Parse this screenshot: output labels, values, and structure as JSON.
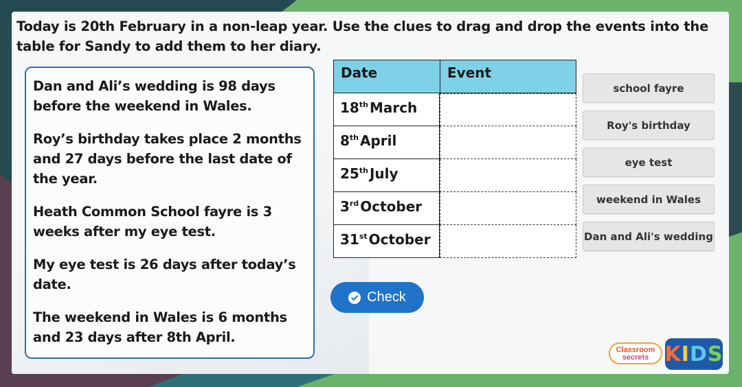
{
  "instructions": "Today is 20th February in a non-leap year. Use the clues to drag and drop the events into the table for Sandy to add them to her diary.",
  "clues": [
    "Dan and Ali’s wedding is 98 days before the weekend in Wales.",
    "Roy’s birthday takes place 2 months and 27 days before the last date of the year.",
    "Heath Common School fayre is 3 weeks after my eye test.",
    "My eye test is 26 days after today’s date.",
    "The weekend in Wales is 6 months and 23 days after 8th April."
  ],
  "table": {
    "headers": {
      "date": "Date",
      "event": "Event"
    },
    "rows": [
      {
        "day": "18",
        "suffix": "th",
        "month": "March"
      },
      {
        "day": "8",
        "suffix": "th",
        "month": "April"
      },
      {
        "day": "25",
        "suffix": "th",
        "month": "July"
      },
      {
        "day": "3",
        "suffix": "rd",
        "month": "October"
      },
      {
        "day": "31",
        "suffix": "st",
        "month": "October"
      }
    ]
  },
  "tiles": [
    "school fayre",
    "Roy's birthday",
    "eye test",
    "weekend in Wales",
    "Dan and Ali's wedding"
  ],
  "check_button": {
    "label": "Check",
    "icon": "check-circle-icon"
  },
  "logo": {
    "classroom": "Classroom",
    "secrets": "secrets",
    "kids_letters": [
      "K",
      "I",
      "D",
      "S"
    ],
    "kids_colors": [
      "#f26b3a",
      "#f7c948",
      "#5cc6e8",
      "#7dd15a"
    ]
  },
  "colors": {
    "header_bg": "#7ed1e6",
    "check_bg": "#1f73c9",
    "clue_border": "#2d6fa8",
    "tile_bg": "#e6e6e6"
  }
}
